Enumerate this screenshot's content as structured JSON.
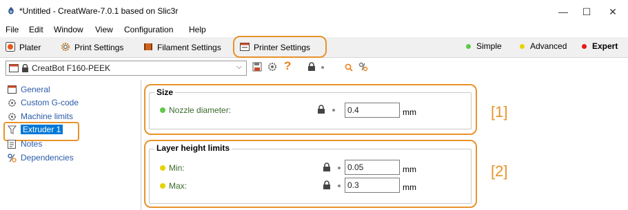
{
  "window": {
    "title": "*Untitled - CreatWare-7.0.1 based on Slic3r",
    "minimize_glyph": "—",
    "maximize_glyph": "☐",
    "close_glyph": "✕"
  },
  "menu": [
    "File",
    "Edit",
    "Window",
    "View",
    "Configuration",
    "Help"
  ],
  "tabs": [
    {
      "label": "Plater",
      "icon": "plater-icon"
    },
    {
      "label": "Print Settings",
      "icon": "gear-icon"
    },
    {
      "label": "Filament Settings",
      "icon": "filament-icon"
    },
    {
      "label": "Printer Settings",
      "icon": "printer-icon"
    }
  ],
  "modes": [
    {
      "label": "Simple",
      "color": "#5fc84a"
    },
    {
      "label": "Advanced",
      "color": "#e8d300"
    },
    {
      "label": "Expert",
      "color": "#e8161b"
    }
  ],
  "preset": {
    "name": "CreatBot F160-PEEK",
    "question_glyph": "?",
    "icons": [
      "save-icon",
      "gear-icon",
      "help-icon",
      "lock-icon",
      "search-icon",
      "compare-icon"
    ]
  },
  "sidebar": {
    "items": [
      {
        "label": "General",
        "icon": "general-icon"
      },
      {
        "label": "Custom G-code",
        "icon": "gcode-icon"
      },
      {
        "label": "Machine limits",
        "icon": "limits-icon"
      },
      {
        "label": "Extruder 1",
        "icon": "extruder-icon",
        "selected": true
      },
      {
        "label": "Notes",
        "icon": "notes-icon"
      },
      {
        "label": "Dependencies",
        "icon": "dependencies-icon"
      }
    ]
  },
  "size_group": {
    "title": "Size",
    "nozzle_label": "Nozzle diameter:",
    "nozzle_value": "0.4",
    "nozzle_unit": "mm",
    "dot_color": "#5fc84a"
  },
  "layer_group": {
    "title": "Layer height limits",
    "min_label": "Min:",
    "min_value": "0.05",
    "min_unit": "mm",
    "max_label": "Max:",
    "max_value": "0.3",
    "max_unit": "mm",
    "dot_color": "#e8d300"
  },
  "annotations": {
    "first": "[1]",
    "second": "[2]"
  },
  "highlight_color": "#e8922a"
}
